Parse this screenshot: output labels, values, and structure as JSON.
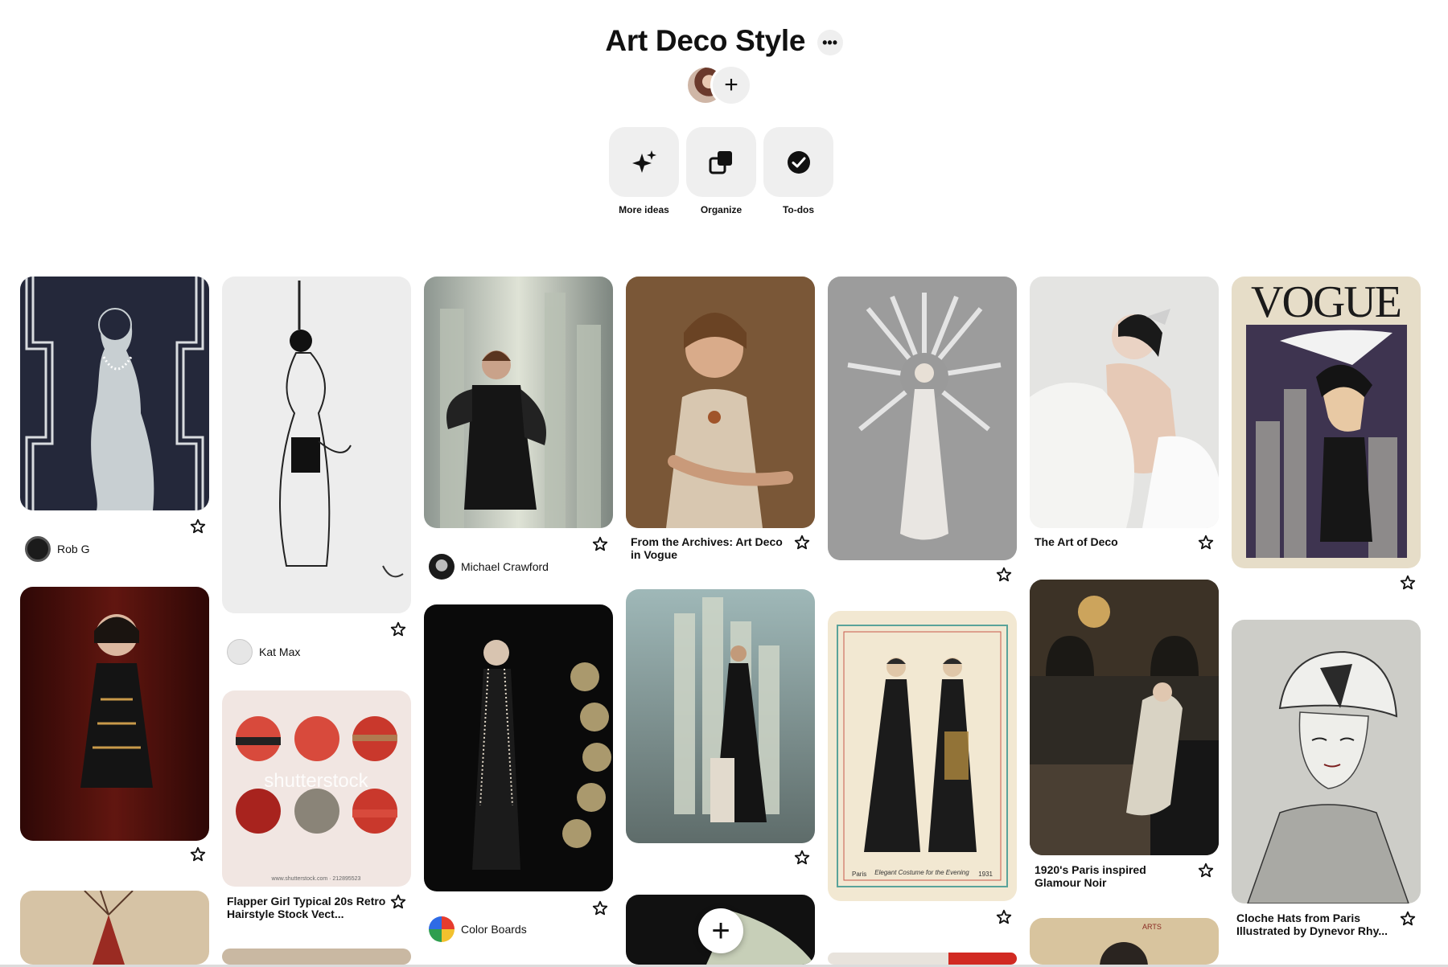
{
  "board": {
    "title": "Art Deco Style",
    "more_label": "•••",
    "add_collaborator_label": "+"
  },
  "actions": [
    {
      "label": "More ideas",
      "icon": "sparkle-icon"
    },
    {
      "label": "Organize",
      "icon": "organize-icon"
    },
    {
      "label": "To-dos",
      "icon": "check-circle-icon"
    }
  ],
  "pins": {
    "p1": {
      "author": "Rob G"
    },
    "p2": {
      "author": "Kat Max"
    },
    "p3": {
      "title": "Flapper Girl Typical 20s Retro Hairstyle Stock Vect...",
      "watermark": "shutterstock",
      "footer": "www.shutterstock.com · 212895523"
    },
    "p4": {
      "author": "Michael Crawford"
    },
    "p5": {
      "author": "Color Boards"
    },
    "p6": {
      "title": "From the Archives: Art Deco in Vogue"
    },
    "p7": {
      "title": "The Art of Deco"
    },
    "p8": {
      "title": "1920's Paris inspired Glamour Noir"
    },
    "p9": {
      "masthead": "VOGUE"
    },
    "p10": {
      "title": "Cloche Hats from Paris Illustrated by Dynevor Rhy..."
    },
    "p11": {
      "caption": "Elegant Costume for the Evening",
      "city": "Paris",
      "year": "1931"
    },
    "p12": {
      "masthead": "ARTS"
    }
  },
  "add_button_label": "+",
  "colors": {
    "button_bg": "#efefef",
    "text": "#111111"
  }
}
